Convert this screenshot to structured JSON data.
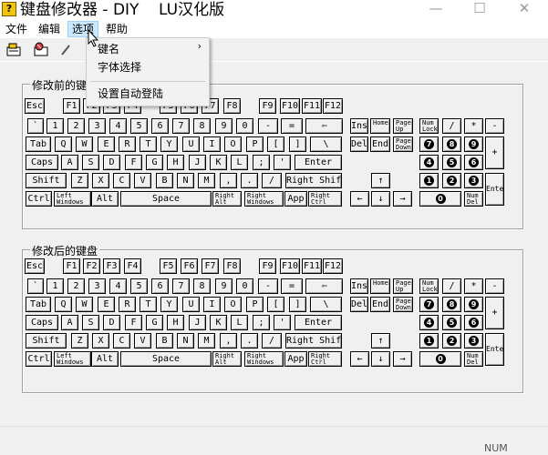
{
  "window": {
    "title": "键盘修改器 - DIY    LU汉化版",
    "icon_label": "?"
  },
  "caption_buttons": {
    "minimize": "—",
    "maximize": "☐",
    "close": "✕"
  },
  "menu": {
    "file": "文件",
    "edit": "编辑",
    "options": "选项",
    "help": "帮助"
  },
  "dropdown": {
    "items": [
      {
        "label": "键名",
        "arrow": "›"
      },
      {
        "label": "字体选择",
        "arrow": ""
      },
      {
        "label": "设置自动登陆",
        "arrow": ""
      }
    ]
  },
  "panels": {
    "before": "修改前的键盘",
    "after": "修改后的键盘"
  },
  "keys": {
    "esc": "Esc",
    "f1": "F1",
    "f2": "F2",
    "f3": "F3",
    "f4": "F4",
    "f5": "F5",
    "f6": "F6",
    "f7": "F7",
    "f8": "F8",
    "f9": "F9",
    "f10": "F10",
    "f11": "F11",
    "f12": "F12",
    "backtick": "`",
    "n1": "1",
    "n2": "2",
    "n3": "3",
    "n4": "4",
    "n5": "5",
    "n6": "6",
    "n7": "7",
    "n8": "8",
    "n9": "9",
    "n0": "0",
    "minus": "-",
    "equals": "=",
    "backspace": "⇦",
    "tab": "Tab",
    "q": "Q",
    "w": "W",
    "e": "E",
    "r": "R",
    "t": "T",
    "y": "Y",
    "u": "U",
    "i": "I",
    "o": "O",
    "p": "P",
    "lbr": "[",
    "rbr": "]",
    "bslash": "\\",
    "caps": "Caps",
    "a": "A",
    "s": "S",
    "d": "D",
    "f": "F",
    "g": "G",
    "h": "H",
    "j": "J",
    "k": "K",
    "l": "L",
    "semi": ";",
    "quote": "'",
    "enter": "Enter",
    "shift": "Shift",
    "z": "Z",
    "x": "X",
    "c": "C",
    "v": "V",
    "b": "B",
    "n": "N",
    "m": "M",
    "comma": ",",
    "period": ".",
    "slash": "/",
    "rshift": "Right Shift",
    "ctrl": "Ctrl",
    "lwin": "Left Windows",
    "alt": "Alt",
    "space": "Space",
    "ralt": "Right Alt",
    "rwin": "Right Windows",
    "app": "App",
    "rctrl": "Right Ctrl",
    "ins": "Ins",
    "home": "Home",
    "pgup": "Page Up",
    "del": "Del",
    "end": "End",
    "pgdn": "Page Down",
    "up": "↑",
    "left": "←",
    "down": "↓",
    "right": "→",
    "numlock": "Num Lock",
    "ndiv": "/",
    "nmul": "*",
    "nsub": "-",
    "nadd": "+",
    "nenter": "Enter",
    "ndel": "Num Del",
    "k7": "7",
    "k8": "8",
    "k9": "9",
    "k4": "4",
    "k5": "5",
    "k6": "6",
    "k1": "1",
    "k2": "2",
    "k3": "3",
    "k0": "0"
  },
  "status": {
    "num": "NUM"
  },
  "colors": {
    "accent": "#cce8ff",
    "icon_yellow": "#f2c500"
  }
}
